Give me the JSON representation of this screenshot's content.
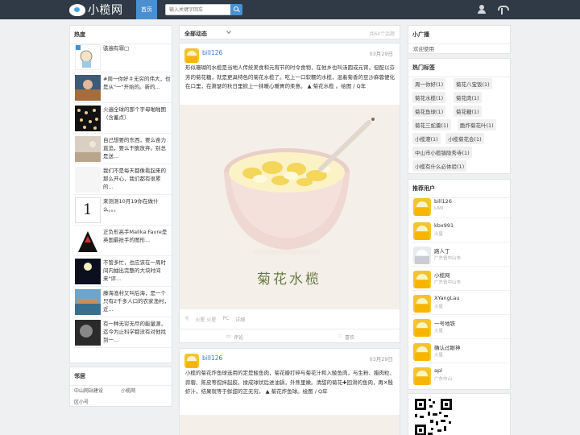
{
  "navbar": {
    "logo_text": "小榄网",
    "home": "首页",
    "search_placeholder": "输入关键字回车"
  },
  "hot": {
    "title": "热度",
    "items": [
      {
        "text": "骇遍有罪□"
      },
      {
        "text": "#周一你好＃无穷的伟大，也是从\"一\"开始的。新的..."
      },
      {
        "text": "火遍全球的那个字母啪啪图（含蓄点）"
      },
      {
        "text": "自己想要的东西，要么奋力直追，要么干脆放弃。别总是送..."
      },
      {
        "text": "我们不是每天都像看起来的那么开心，我们都有很累的..."
      },
      {
        "text": "来测测10月19你在做什么。。。"
      },
      {
        "text": "正负形高手Malika Favre是英国最抢手的图形..."
      },
      {
        "text": "不管多忙，也应该在一周时间内抽出完整的大块时间来\"评..."
      },
      {
        "text": "藤海渔村又叫后海，是一个只有2千多人口的农家渔村，近..."
      },
      {
        "text": "有一种无穷无尽的能量源，迄今为止科学都没有对他找到一..."
      }
    ],
    "badge_1": "1"
  },
  "neighbors": {
    "title": "邻居",
    "links": [
      "中山网站建设",
      "小榄网",
      "区小号"
    ]
  },
  "feed": {
    "filter": "全部动态",
    "right_note": "共64个话题"
  },
  "posts": [
    {
      "author": "bill126",
      "date": "03月29日",
      "body": "形似珊瑚的水榄是当地人传统美食和元宵节的时令食物，在他乡也叫汤圆或元宵，但配以芬芳的菊花糖，就是更具特色的菊花水榄了。吃上一口软糯的水榄，混着菊香的豆沙麻蓉便化在口里，在萧瑟的秋日里掀上一抹暖心暖胃的柔意。 ▲ 菊花水榄 。绘图 / Q年",
      "image_caption": "菊花水榄",
      "meta": [
        "火星 火星",
        "PC",
        "详细"
      ],
      "actions": {
        "comment": "评论",
        "like": "喜欢"
      }
    },
    {
      "author": "bill126",
      "date": "03月29日",
      "body": "小榄的菊花炸鱼球选用的定是鲮鱼肉，菊花瓣打碎与菊花汁和入鲮鱼肉，与生粉、腊肉粒、蒜蓉、陈皮等搅拌起胶，揉成球状后进油锅，外焦里嫩。清甜的菊花✚回滑的鱼肉，再✕殷虾汁，结果就等于鲜甜的正无穷。 ▲ 菊花炸鱼球。绘图 / Q年"
    }
  ],
  "broadcast": {
    "title": "小广播",
    "text": "欢迎使用"
  },
  "tags": {
    "title": "热门标签",
    "items": [
      "周一你好(1)",
      "菊花八宝饭(1)",
      "菊花水榄(1)",
      "菊花肉(1)",
      "菊花鱼球(1)",
      "菊花糖(1)",
      "菊花三蛇羹(1)",
      "脆炸菊花叶(1)",
      "小榄港(1)",
      "小榄菊花会(1)",
      "中山市小榄镇隐秀寺(1)",
      "小榄有什么必体验(1)"
    ]
  },
  "recommend": {
    "title": "推荐用户",
    "users": [
      {
        "name": "bill126",
        "loc": "LAN"
      },
      {
        "name": "kbx991",
        "loc": "火星"
      },
      {
        "name": "路人丁",
        "loc": "广东省中山市"
      },
      {
        "name": "小榄网",
        "loc": "广东省中山市"
      },
      {
        "name": "XYangLau",
        "loc": "火星"
      },
      {
        "name": "一号地铁",
        "loc": "火星"
      },
      {
        "name": "确认过眼神",
        "loc": "火星"
      },
      {
        "name": "apl",
        "loc": "广东中山"
      }
    ]
  }
}
